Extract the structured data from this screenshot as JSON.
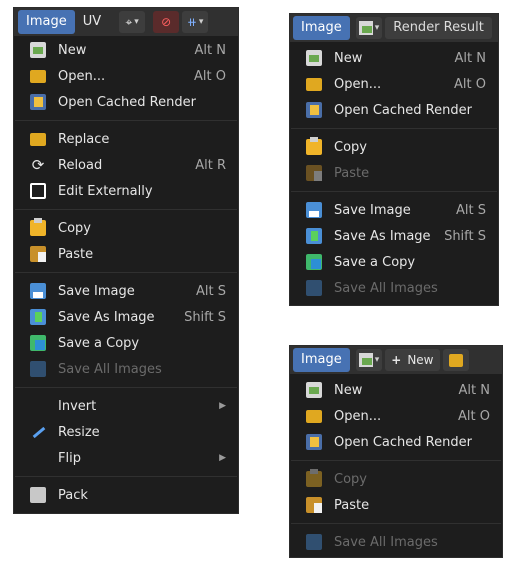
{
  "colors": {
    "menu_bg": "#1d1d1d",
    "header_bg": "#303030",
    "accent": "#4772b3",
    "text": "#e6e6e6",
    "shortcut": "#a8a8a8",
    "disabled": "#6b6b6b"
  },
  "panel1": {
    "tab_image": "Image",
    "tab_uv": "UV",
    "items": [
      {
        "label": "New",
        "shortcut": "Alt N",
        "icon": "new-image-icon"
      },
      {
        "label": "Open...",
        "shortcut": "Alt O",
        "icon": "folder-icon"
      },
      {
        "label": "Open Cached Render",
        "shortcut": "",
        "icon": "cached-render-icon"
      },
      {
        "label": "Replace",
        "shortcut": "",
        "icon": "folder-icon"
      },
      {
        "label": "Reload",
        "shortcut": "Alt R",
        "icon": "reload-icon"
      },
      {
        "label": "Edit Externally",
        "shortcut": "",
        "icon": "external-edit-icon"
      },
      {
        "label": "Copy",
        "shortcut": "",
        "icon": "copy-icon"
      },
      {
        "label": "Paste",
        "shortcut": "",
        "icon": "paste-icon"
      },
      {
        "label": "Save Image",
        "shortcut": "Alt S",
        "icon": "save-icon"
      },
      {
        "label": "Save As Image",
        "shortcut": "Shift S",
        "icon": "save-as-icon"
      },
      {
        "label": "Save a Copy",
        "shortcut": "",
        "icon": "save-copy-icon"
      },
      {
        "label": "Save All Images",
        "shortcut": "",
        "icon": "save-all-icon"
      },
      {
        "label": "Invert",
        "shortcut": "",
        "icon": "none"
      },
      {
        "label": "Resize",
        "shortcut": "",
        "icon": "resize-icon"
      },
      {
        "label": "Flip",
        "shortcut": "",
        "icon": "none"
      },
      {
        "label": "Pack",
        "shortcut": "",
        "icon": "pack-icon"
      }
    ]
  },
  "panel2": {
    "tab_image": "Image",
    "render_result": "Render Result",
    "items": [
      {
        "label": "New",
        "shortcut": "Alt N"
      },
      {
        "label": "Open...",
        "shortcut": "Alt O"
      },
      {
        "label": "Open Cached Render",
        "shortcut": ""
      },
      {
        "label": "Copy",
        "shortcut": ""
      },
      {
        "label": "Paste",
        "shortcut": ""
      },
      {
        "label": "Save Image",
        "shortcut": "Alt S"
      },
      {
        "label": "Save As Image",
        "shortcut": "Shift S"
      },
      {
        "label": "Save a Copy",
        "shortcut": ""
      },
      {
        "label": "Save All Images",
        "shortcut": ""
      }
    ]
  },
  "panel3": {
    "tab_image": "Image",
    "new_label": "New",
    "items": [
      {
        "label": "New",
        "shortcut": "Alt N"
      },
      {
        "label": "Open...",
        "shortcut": "Alt O"
      },
      {
        "label": "Open Cached Render",
        "shortcut": ""
      },
      {
        "label": "Copy",
        "shortcut": ""
      },
      {
        "label": "Paste",
        "shortcut": ""
      },
      {
        "label": "Save All Images",
        "shortcut": ""
      }
    ]
  }
}
